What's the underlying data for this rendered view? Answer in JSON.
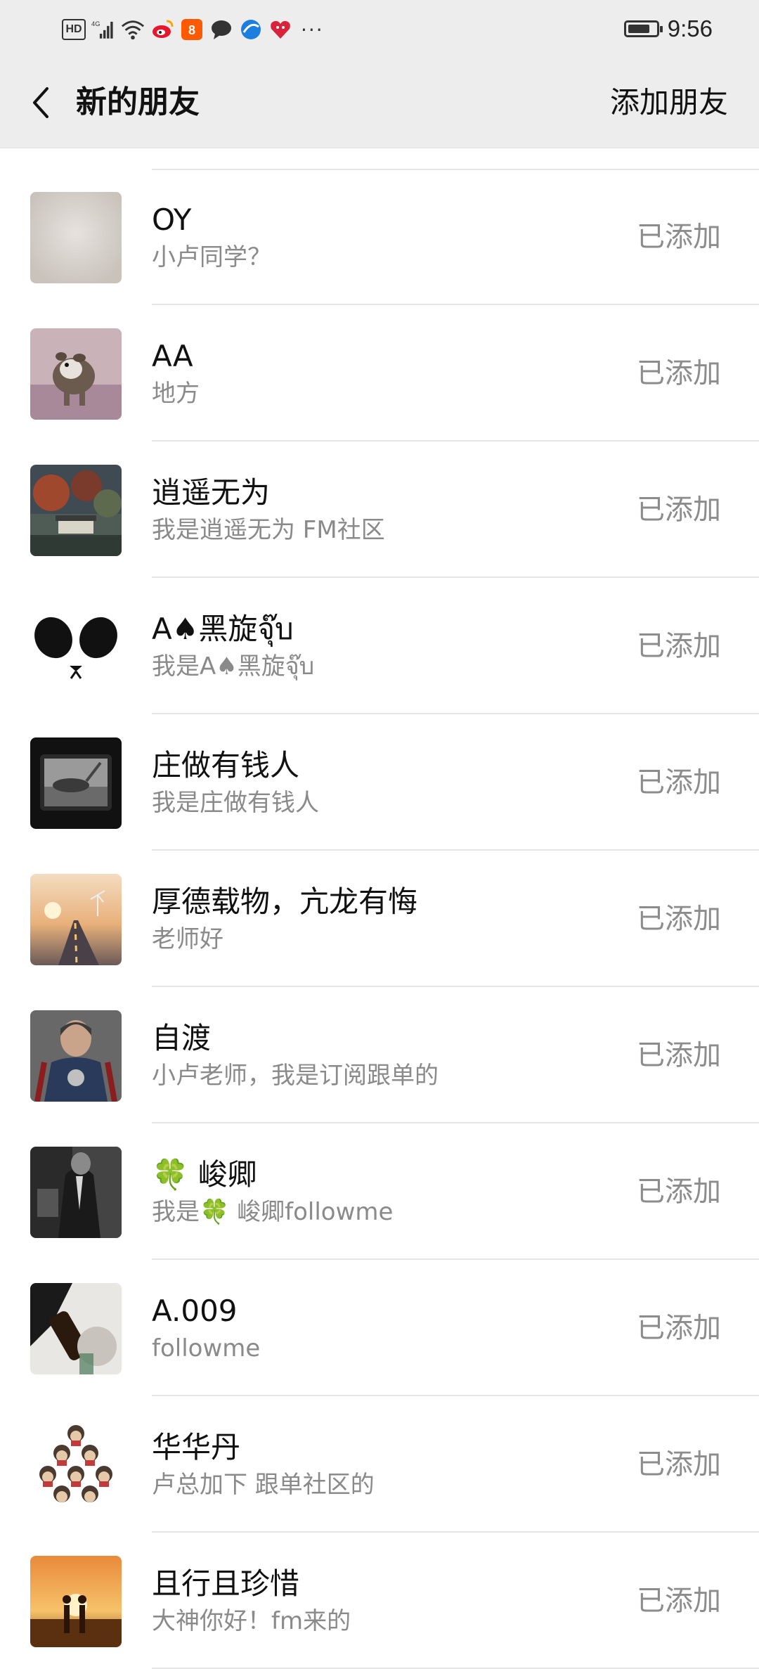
{
  "status_bar": {
    "left_icons": [
      "hd-icon",
      "4g-signal-icon",
      "wifi-icon",
      "weibo-icon",
      "app-icon",
      "chat-bubble-icon",
      "browser-icon",
      "heart-app-icon"
    ],
    "network_label": "4G",
    "hd_label": "HD",
    "more": "···",
    "time": "9:56",
    "battery_level": 0.8
  },
  "nav": {
    "back_icon": "chevron-left-icon",
    "title": "新的朋友",
    "action": "添加朋友"
  },
  "friends": [
    {
      "name": "OY",
      "message": "小卢同学？",
      "status": "已添加",
      "avatar": "beige"
    },
    {
      "name": "AA",
      "message": "地方",
      "status": "已添加",
      "avatar": "dog"
    },
    {
      "name": "逍遥无为",
      "message": "我是逍遥无为   FM社区",
      "status": "已添加",
      "avatar": "landscape"
    },
    {
      "name": "A♠黑旋จุ๊บ",
      "message": "我是A♠黑旋จุ๊บ",
      "status": "已添加",
      "avatar": "panda"
    },
    {
      "name": "庄做有钱人",
      "message": "我是庄做有钱人",
      "status": "已添加",
      "avatar": "tv"
    },
    {
      "name": "厚德载物，亢龙有悔",
      "message": "老师好",
      "status": "已添加",
      "avatar": "road"
    },
    {
      "name": "自渡",
      "message": "小卢老师，我是订阅跟单的",
      "status": "已添加",
      "avatar": "hero"
    },
    {
      "name": "🍀 峻卿",
      "message": "我是🍀 峻卿followme",
      "status": "已添加",
      "avatar": "suit"
    },
    {
      "name": "A.009",
      "message": "followme",
      "status": "已添加",
      "avatar": "bottle"
    },
    {
      "name": "华华丹",
      "message": "卢总加下 跟单社区的",
      "status": "已添加",
      "avatar": "crowd"
    },
    {
      "name": "且行且珍惜",
      "message": "大神你好！fm来的",
      "status": "已添加",
      "avatar": "sunset"
    }
  ]
}
